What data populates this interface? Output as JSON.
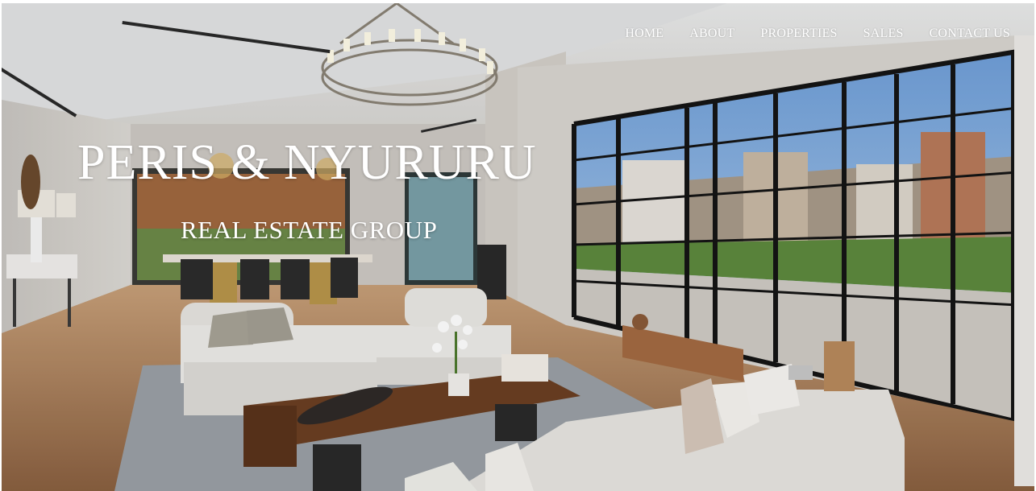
{
  "nav": {
    "items": [
      {
        "label": "HOME"
      },
      {
        "label": "ABOUT"
      },
      {
        "label": "PROPERTIES"
      },
      {
        "label": "SALES"
      },
      {
        "label": "CONTACT US"
      }
    ]
  },
  "hero": {
    "brand": "PERIS & NYURURU",
    "tagline": "REAL ESTATE GROUP"
  },
  "colors": {
    "nav_text": "#ffffff",
    "hero_text": "#ffffff"
  }
}
